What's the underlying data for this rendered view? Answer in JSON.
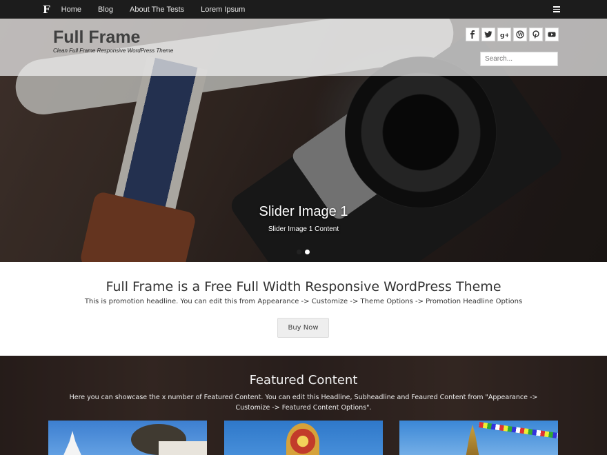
{
  "nav": {
    "logo": "F",
    "items": [
      {
        "label": "Home"
      },
      {
        "label": "Blog"
      },
      {
        "label": "About The Tests"
      },
      {
        "label": "Lorem Ipsum"
      }
    ],
    "menu_icon": "list-icon"
  },
  "header": {
    "site_title": "Full Frame",
    "tagline": "Clean Full Frame Responsive WordPress Theme",
    "social_icons": [
      "facebook-icon",
      "twitter-icon",
      "google-plus-icon",
      "wordpress-icon",
      "pinterest-icon",
      "youtube-icon"
    ],
    "search_placeholder": "Search..."
  },
  "slider": {
    "title": "Slider Image 1",
    "subtitle": "Slider Image 1 Content",
    "slide_count": 2,
    "active_slide": 2
  },
  "promotion": {
    "headline": "Full Frame is a Free Full Width Responsive WordPress Theme",
    "subheadline": "This is promotion headline. You can edit this from Appearance -> Customize -> Theme Options -> Promotion Headline Options",
    "button_label": "Buy Now"
  },
  "featured": {
    "title": "Featured Content",
    "subtitle": "Here you can showcase the x number of Featured Content. You can edit this Headline, Subheadline and Feaured Content from \"Appearance -> Customize -> Featured Content Options\"."
  },
  "colors": {
    "topbar": "#1c1c1c",
    "title": "#404040",
    "accent_dot_active": "#ffffff"
  }
}
